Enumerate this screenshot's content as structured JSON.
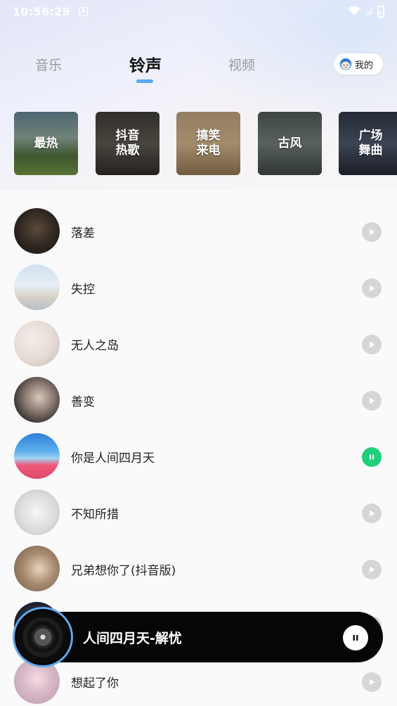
{
  "status_bar": {
    "time": "10:56:29",
    "notification_badge": "A"
  },
  "tabs": [
    {
      "label": "音乐",
      "active": false
    },
    {
      "label": "铃声",
      "active": true
    },
    {
      "label": "视频",
      "active": false
    }
  ],
  "mine": {
    "label": "我的",
    "icon": "kid-face-icon"
  },
  "categories": [
    {
      "label": "最热"
    },
    {
      "label": "抖音\n热歌"
    },
    {
      "label": "搞笑\n来电"
    },
    {
      "label": "古风"
    },
    {
      "label": "广场\n舞曲"
    }
  ],
  "songs": [
    {
      "title": "落差",
      "state": "play"
    },
    {
      "title": "失控",
      "state": "play"
    },
    {
      "title": "无人之岛",
      "state": "play"
    },
    {
      "title": "善变",
      "state": "play"
    },
    {
      "title": "你是人间四月天",
      "state": "pause"
    },
    {
      "title": "不知所措",
      "state": "play"
    },
    {
      "title": "兄弟想你了(抖音版)",
      "state": "play"
    },
    {
      "title": "",
      "state": "play"
    },
    {
      "title": "想起了你",
      "state": "play"
    }
  ],
  "player": {
    "now_playing": "人间四月天-解忧",
    "state": "playing"
  },
  "colors": {
    "accent": "#58a8f2",
    "active_play": "#1fcf7a",
    "inactive_play": "#d6d6d8",
    "player_bg": "#060606"
  }
}
